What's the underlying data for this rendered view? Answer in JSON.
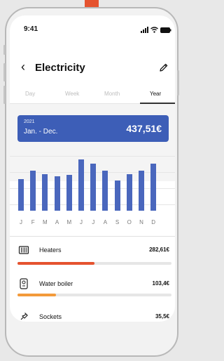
{
  "status_bar": {
    "time": "9:41"
  },
  "header": {
    "title": "Electricity",
    "back_icon": "chevron-left-icon",
    "edit_icon": "pencil-icon"
  },
  "tabs": [
    {
      "label": "Day",
      "active": false
    },
    {
      "label": "Week",
      "active": false
    },
    {
      "label": "Month",
      "active": false
    },
    {
      "label": "Year",
      "active": true
    }
  ],
  "summary": {
    "year": "2021",
    "range": "Jan. - Dec.",
    "total": "437,51€",
    "color": "#3d5eb7"
  },
  "chart_data": {
    "type": "bar",
    "categories": [
      "J",
      "F",
      "M",
      "A",
      "M",
      "J",
      "J",
      "A",
      "S",
      "O",
      "N",
      "D"
    ],
    "values": [
      30,
      38,
      35,
      33,
      34,
      49,
      45,
      38,
      29,
      35,
      38,
      45
    ],
    "ylim": [
      0,
      52
    ],
    "grid": true,
    "bar_color": "#4a67bd"
  },
  "breakdown": [
    {
      "label": "Heaters",
      "value": "282,61€",
      "share": 0.5,
      "icon": "heater-icon"
    },
    {
      "label": "Water boiler",
      "value": "103,4€",
      "share": 0.25,
      "icon": "water-boiler-icon"
    },
    {
      "label": "Sockets",
      "value": "35,5€",
      "share": 0.08,
      "icon": "plug-icon"
    }
  ]
}
